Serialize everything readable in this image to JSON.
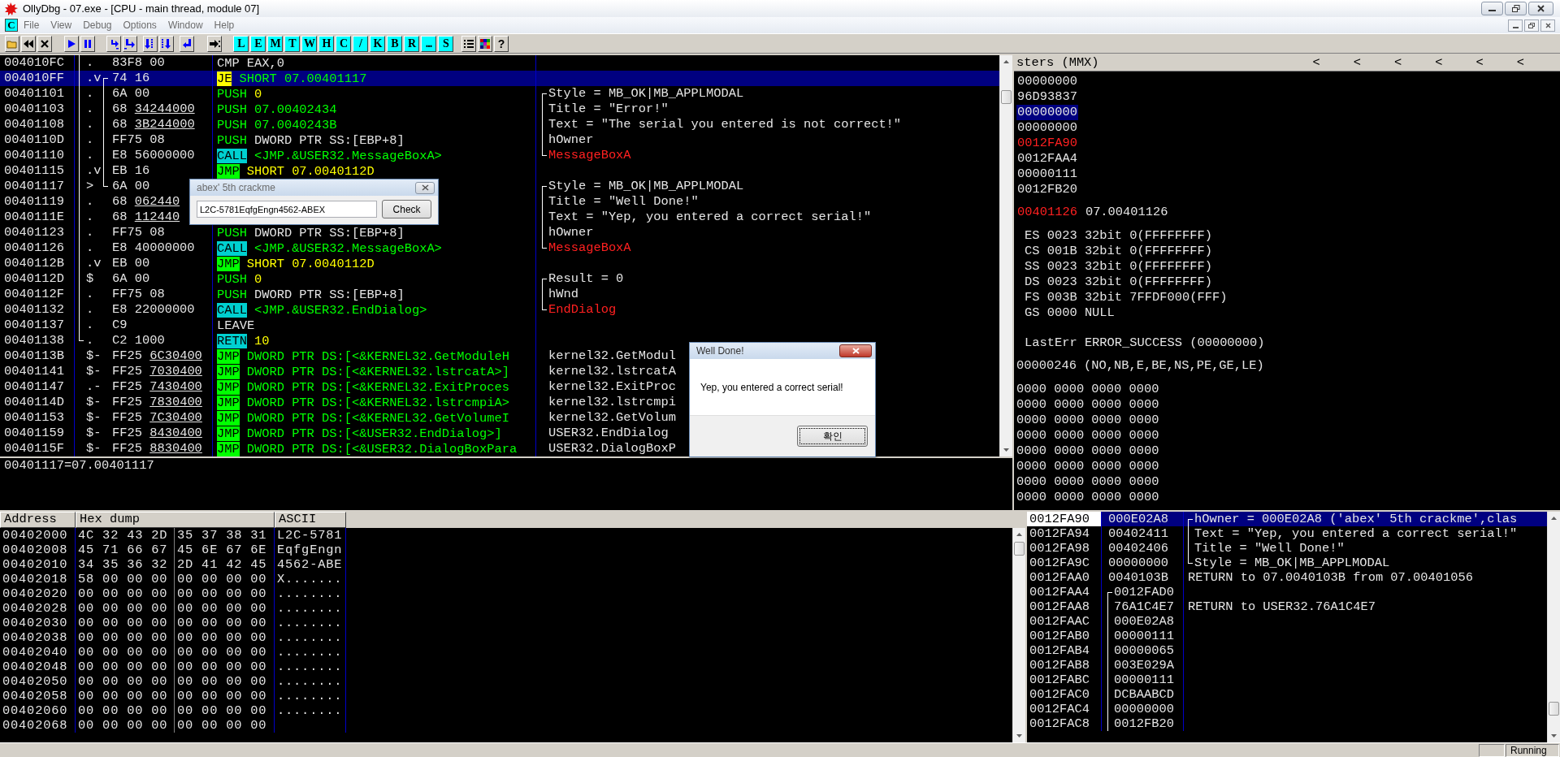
{
  "window": {
    "title": "OllyDbg - 07.exe - [CPU - main thread, module 07]"
  },
  "menu": {
    "icon_letter": "C",
    "items": [
      "File",
      "View",
      "Debug",
      "Options",
      "Window",
      "Help"
    ]
  },
  "toolbar": {
    "letter_buttons": [
      "L",
      "E",
      "M",
      "T",
      "W",
      "H",
      "C",
      "/",
      "K",
      "B",
      "R",
      "...",
      "S"
    ],
    "help_button": "?"
  },
  "disassembly": {
    "rows": [
      {
        "address": "004010FC",
        "mark": ".",
        "hex": "83F8 00",
        "mnemonic": {
          "text": "CMP",
          "kind": "plain"
        },
        "operand": {
          "text": "EAX,0",
          "kind": "plain"
        },
        "selected": false,
        "proc_bracket": {
          "kind": "middle"
        }
      },
      {
        "address": "004010FF",
        "mark": ".v",
        "hex": "74 16",
        "mnemonic": {
          "text": "JE",
          "kind": "cond_jump"
        },
        "operand": {
          "text": "SHORT 07.00401117",
          "kind": "label"
        },
        "selected": true,
        "proc_bracket": {
          "kind": "middle"
        },
        "jump_bracket": {
          "kind": "top"
        }
      },
      {
        "address": "00401101",
        "mark": ".",
        "hex": "6A 00",
        "mnemonic": {
          "text": "PUSH",
          "kind": "push"
        },
        "operand": {
          "text": "0",
          "kind": "const"
        },
        "comment": {
          "text": "Style = MB_OK|MB_APPLMODAL",
          "kind": "plain"
        },
        "comment_bracket": {
          "kind": "top"
        },
        "selected": false,
        "proc_bracket": {
          "kind": "middle"
        },
        "jump_bracket": {
          "kind": "middle"
        }
      },
      {
        "address": "00401103",
        "mark": ".",
        "hex": "68",
        "fixup": "34244000",
        "mnemonic": {
          "text": "PUSH",
          "kind": "push"
        },
        "operand": {
          "text": "07.00402434",
          "kind": "label"
        },
        "comment": {
          "text": "Title = \"Error!\"",
          "kind": "plain"
        },
        "comment_bracket": {
          "kind": "middle"
        },
        "selected": false,
        "proc_bracket": {
          "kind": "middle"
        },
        "jump_bracket": {
          "kind": "middle"
        }
      },
      {
        "address": "00401108",
        "mark": ".",
        "hex": "68",
        "fixup": "3B244000",
        "mnemonic": {
          "text": "PUSH",
          "kind": "push"
        },
        "operand": {
          "text": "07.0040243B",
          "kind": "label"
        },
        "comment": {
          "text": "Text = \"The serial you entered is not correct!\"",
          "kind": "plain"
        },
        "comment_bracket": {
          "kind": "middle"
        },
        "selected": false,
        "proc_bracket": {
          "kind": "middle"
        },
        "jump_bracket": {
          "kind": "middle"
        }
      },
      {
        "address": "0040110D",
        "mark": ".",
        "hex": "FF75 08",
        "mnemonic": {
          "text": "PUSH",
          "kind": "push"
        },
        "operand": {
          "text": "DWORD PTR SS:[EBP+8]",
          "kind": "plain"
        },
        "comment": {
          "text": "hOwner",
          "kind": "plain"
        },
        "comment_bracket": {
          "kind": "middle"
        },
        "selected": false,
        "proc_bracket": {
          "kind": "middle"
        },
        "jump_bracket": {
          "kind": "middle"
        }
      },
      {
        "address": "00401110",
        "mark": ".",
        "hex": "E8 56000000",
        "mnemonic": {
          "text": "CALL",
          "kind": "call"
        },
        "operand": {
          "text": "<JMP.&USER32.MessageBoxA>",
          "kind": "label"
        },
        "comment": {
          "text": "MessageBoxA",
          "kind": "api"
        },
        "comment_bracket": {
          "kind": "bottom"
        },
        "selected": false,
        "proc_bracket": {
          "kind": "middle"
        },
        "jump_bracket": {
          "kind": "middle"
        }
      },
      {
        "address": "00401115",
        "mark": ".v",
        "hex": "EB 16",
        "mnemonic": {
          "text": "JMP",
          "kind": "jump"
        },
        "operand": {
          "text": "SHORT 07.0040112D",
          "kind": "const"
        },
        "selected": false,
        "proc_bracket": {
          "kind": "middle"
        },
        "jump_bracket": {
          "kind": "middle"
        }
      },
      {
        "address": "00401117",
        "mark": ">",
        "hex": "6A 00",
        "comment": {
          "text": "Style = MB_OK|MB_APPLMODAL",
          "kind": "plain"
        },
        "comment_bracket": {
          "kind": "top"
        },
        "selected": false,
        "proc_bracket": {
          "kind": "middle"
        },
        "jump_bracket": {
          "kind": "bottom"
        }
      },
      {
        "address": "00401119",
        "mark": ".",
        "hex": "68",
        "fixup": "062440",
        "comment": {
          "text": "Title = \"Well Done!\"",
          "kind": "plain"
        },
        "comment_bracket": {
          "kind": "middle"
        },
        "selected": false,
        "proc_bracket": {
          "kind": "middle"
        }
      },
      {
        "address": "0040111E",
        "mark": ".",
        "hex": "68",
        "fixup": "112440",
        "comment": {
          "text": "Text = \"Yep, you entered a correct serial!\"",
          "kind": "plain"
        },
        "comment_bracket": {
          "kind": "middle"
        },
        "selected": false,
        "proc_bracket": {
          "kind": "middle"
        }
      },
      {
        "address": "00401123",
        "mark": ".",
        "hex": "FF75 08",
        "mnemonic": {
          "text": "PUSH",
          "kind": "push"
        },
        "operand": {
          "text": "DWORD PTR SS:[EBP+8]",
          "kind": "plain"
        },
        "comment": {
          "text": "hOwner",
          "kind": "plain"
        },
        "comment_bracket": {
          "kind": "middle"
        },
        "selected": false,
        "proc_bracket": {
          "kind": "middle"
        }
      },
      {
        "address": "00401126",
        "mark": ".",
        "hex": "E8 40000000",
        "mnemonic": {
          "text": "CALL",
          "kind": "call"
        },
        "operand": {
          "text": "<JMP.&USER32.MessageBoxA>",
          "kind": "label"
        },
        "comment": {
          "text": "MessageBoxA",
          "kind": "api"
        },
        "comment_bracket": {
          "kind": "bottom"
        },
        "selected": false,
        "proc_bracket": {
          "kind": "middle"
        }
      },
      {
        "address": "0040112B",
        "mark": ".v",
        "hex": "EB 00",
        "mnemonic": {
          "text": "JMP",
          "kind": "jump"
        },
        "operand": {
          "text": "SHORT 07.0040112D",
          "kind": "const"
        },
        "selected": false,
        "proc_bracket": {
          "kind": "middle"
        }
      },
      {
        "address": "0040112D",
        "mark": "$",
        "hex": "6A 00",
        "mnemonic": {
          "text": "PUSH",
          "kind": "push"
        },
        "operand": {
          "text": "0",
          "kind": "const"
        },
        "comment": {
          "text": "Result = 0",
          "kind": "plain"
        },
        "comment_bracket": {
          "kind": "top"
        },
        "selected": false,
        "proc_bracket": {
          "kind": "middle"
        }
      },
      {
        "address": "0040112F",
        "mark": ".",
        "hex": "FF75 08",
        "mnemonic": {
          "text": "PUSH",
          "kind": "push"
        },
        "operand": {
          "text": "DWORD PTR SS:[EBP+8]",
          "kind": "plain"
        },
        "comment": {
          "text": "hWnd",
          "kind": "plain"
        },
        "comment_bracket": {
          "kind": "middle"
        },
        "selected": false,
        "proc_bracket": {
          "kind": "middle"
        }
      },
      {
        "address": "00401132",
        "mark": ".",
        "hex": "E8 22000000",
        "mnemonic": {
          "text": "CALL",
          "kind": "call"
        },
        "operand": {
          "text": "<JMP.&USER32.EndDialog>",
          "kind": "label"
        },
        "comment": {
          "text": "EndDialog",
          "kind": "api"
        },
        "comment_bracket": {
          "kind": "bottom"
        },
        "selected": false,
        "proc_bracket": {
          "kind": "middle"
        }
      },
      {
        "address": "00401137",
        "mark": ".",
        "hex": "C9",
        "mnemonic": {
          "text": "LEAVE",
          "kind": "plain"
        },
        "selected": false,
        "proc_bracket": {
          "kind": "middle"
        }
      },
      {
        "address": "00401138",
        "mark": ".",
        "hex": "C2 1000",
        "mnemonic": {
          "text": "RETN",
          "kind": "return"
        },
        "operand": {
          "text": "10",
          "kind": "const"
        },
        "selected": false,
        "proc_bracket": {
          "kind": "bottom"
        }
      },
      {
        "address": "0040113B",
        "mark": "$-",
        "hex": "FF25",
        "fixup": "6C30400",
        "mnemonic": {
          "text": "JMP",
          "kind": "jump"
        },
        "operand": {
          "text": "DWORD PTR DS:[<&KERNEL32.GetModuleH",
          "kind": "label"
        },
        "comment": {
          "text": "kernel32.GetModul",
          "kind": "plain"
        },
        "selected": false
      },
      {
        "address": "00401141",
        "mark": "$-",
        "hex": "FF25",
        "fixup": "7030400",
        "mnemonic": {
          "text": "JMP",
          "kind": "jump"
        },
        "operand": {
          "text": "DWORD PTR DS:[<&KERNEL32.lstrcatA>]",
          "kind": "label"
        },
        "comment": {
          "text": "kernel32.lstrcatA",
          "kind": "plain"
        },
        "selected": false
      },
      {
        "address": "00401147",
        "mark": ".-",
        "hex": "FF25",
        "fixup": "7430400",
        "mnemonic": {
          "text": "JMP",
          "kind": "jump"
        },
        "operand": {
          "text": "DWORD PTR DS:[<&KERNEL32.ExitProces",
          "kind": "label"
        },
        "comment": {
          "text": "kernel32.ExitProc",
          "kind": "plain"
        },
        "selected": false
      },
      {
        "address": "0040114D",
        "mark": "$-",
        "hex": "FF25",
        "fixup": "7830400",
        "mnemonic": {
          "text": "JMP",
          "kind": "jump"
        },
        "operand": {
          "text": "DWORD PTR DS:[<&KERNEL32.lstrcmpiA>",
          "kind": "label"
        },
        "comment": {
          "text": "kernel32.lstrcmpi",
          "kind": "plain"
        },
        "selected": false
      },
      {
        "address": "00401153",
        "mark": "$-",
        "hex": "FF25",
        "fixup": "7C30400",
        "mnemonic": {
          "text": "JMP",
          "kind": "jump"
        },
        "operand": {
          "text": "DWORD PTR DS:[<&KERNEL32.GetVolumeI",
          "kind": "label"
        },
        "comment": {
          "text": "kernel32.GetVolum",
          "kind": "plain"
        },
        "selected": false
      },
      {
        "address": "00401159",
        "mark": "$-",
        "hex": "FF25",
        "fixup": "8430400",
        "mnemonic": {
          "text": "JMP",
          "kind": "jump"
        },
        "operand": {
          "text": "DWORD PTR DS:[<&USER32.EndDialog>]",
          "kind": "label"
        },
        "comment": {
          "text": "USER32.EndDialog",
          "kind": "plain"
        },
        "selected": false
      },
      {
        "address": "0040115F",
        "mark": "$-",
        "hex": "FF25",
        "fixup": "8830400",
        "mnemonic": {
          "text": "JMP",
          "kind": "jump"
        },
        "operand": {
          "text": "DWORD PTR DS:[<&USER32.DialogBoxPara",
          "kind": "label"
        },
        "comment": {
          "text": "USER32.DialogBoxP",
          "kind": "plain"
        },
        "selected": false
      }
    ],
    "info_line": "00401117=07.00401117"
  },
  "registers": {
    "header": "sters (MMX)",
    "header_buttons": [
      "<",
      "<",
      "<",
      "<",
      "<",
      "<"
    ],
    "general": [
      {
        "value": "00000000",
        "changed": false,
        "selected": false
      },
      {
        "value": "96D93837",
        "changed": false,
        "selected": false
      },
      {
        "value": "00000000",
        "changed": false,
        "selected": true
      },
      {
        "value": "00000000",
        "changed": false,
        "selected": false
      },
      {
        "value": "0012FA90",
        "changed": true,
        "selected": false
      },
      {
        "value": "0012FAA4",
        "changed": false,
        "selected": false
      },
      {
        "value": "00000111",
        "changed": false,
        "selected": false
      },
      {
        "value": "0012FB20",
        "changed": false,
        "selected": false
      }
    ],
    "eip": {
      "value": "00401126",
      "changed": true,
      "comment": "07.00401126"
    },
    "segments": [
      "ES 0023 32bit 0(FFFFFFFF)",
      "CS 001B 32bit 0(FFFFFFFF)",
      "SS 0023 32bit 0(FFFFFFFF)",
      "DS 0023 32bit 0(FFFFFFFF)",
      "FS 003B 32bit 7FFDF000(FFF)",
      "GS 0000 NULL"
    ],
    "last_error": "LastErr ERROR_SUCCESS (00000000)",
    "flags": "00000246 (NO,NB,E,BE,NS,PE,GE,LE)",
    "mmx": [
      "0000 0000 0000 0000",
      "0000 0000 0000 0000",
      "0000 0000 0000 0000",
      "0000 0000 0000 0000",
      "0000 0000 0000 0000",
      "0000 0000 0000 0000",
      "0000 0000 0000 0000",
      "0000 0000 0000 0000"
    ]
  },
  "dump": {
    "columns": [
      "Address",
      "Hex dump",
      "ASCII"
    ],
    "rows": [
      {
        "address": "00402000",
        "hex_1": "4C 32 43 2D",
        "hex_2": "35 37 38 31",
        "ascii": "L2C-5781"
      },
      {
        "address": "00402008",
        "hex_1": "45 71 66 67",
        "hex_2": "45 6E 67 6E",
        "ascii": "EqfgEngn"
      },
      {
        "address": "00402010",
        "hex_1": "34 35 36 32",
        "hex_2": "2D 41 42 45",
        "ascii": "4562-ABE"
      },
      {
        "address": "00402018",
        "hex_1": "58 00 00 00",
        "hex_2": "00 00 00 00",
        "ascii": "X......."
      },
      {
        "address": "00402020",
        "hex_1": "00 00 00 00",
        "hex_2": "00 00 00 00",
        "ascii": "........"
      },
      {
        "address": "00402028",
        "hex_1": "00 00 00 00",
        "hex_2": "00 00 00 00",
        "ascii": "........"
      },
      {
        "address": "00402030",
        "hex_1": "00 00 00 00",
        "hex_2": "00 00 00 00",
        "ascii": "........"
      },
      {
        "address": "00402038",
        "hex_1": "00 00 00 00",
        "hex_2": "00 00 00 00",
        "ascii": "........"
      },
      {
        "address": "00402040",
        "hex_1": "00 00 00 00",
        "hex_2": "00 00 00 00",
        "ascii": "........"
      },
      {
        "address": "00402048",
        "hex_1": "00 00 00 00",
        "hex_2": "00 00 00 00",
        "ascii": "........"
      },
      {
        "address": "00402050",
        "hex_1": "00 00 00 00",
        "hex_2": "00 00 00 00",
        "ascii": "........"
      },
      {
        "address": "00402058",
        "hex_1": "00 00 00 00",
        "hex_2": "00 00 00 00",
        "ascii": "........"
      },
      {
        "address": "00402060",
        "hex_1": "00 00 00 00",
        "hex_2": "00 00 00 00",
        "ascii": "........"
      },
      {
        "address": "00402068",
        "hex_1": "00 00 00 00",
        "hex_2": "00 00 00 00"
      }
    ]
  },
  "stack": {
    "rows": [
      {
        "address": "0012FA90",
        "value": "000E02A8",
        "comment": "hOwner = 000E02A8 ('abex' 5th crackme',clas",
        "comment_bracket": {
          "kind": "top"
        },
        "selected": true
      },
      {
        "address": "0012FA94",
        "value": "00402411",
        "comment": "Text = \"Yep, you entered a correct serial!\"",
        "comment_bracket": {
          "kind": "middle"
        },
        "selected": false
      },
      {
        "address": "0012FA98",
        "value": "00402406",
        "comment": "Title = \"Well Done!\"",
        "comment_bracket": {
          "kind": "middle"
        },
        "selected": false
      },
      {
        "address": "0012FA9C",
        "value": "00000000",
        "comment": "Style = MB_OK|MB_APPLMODAL",
        "comment_bracket": {
          "kind": "bottom"
        },
        "selected": false
      },
      {
        "address": "0012FAA0",
        "value": "0040103B",
        "comment": "RETURN to 07.0040103B from 07.00401056",
        "selected": false
      },
      {
        "address": "0012FAA4",
        "value": "0012FAD0",
        "value_bracket": {
          "kind": "top"
        },
        "selected": false
      },
      {
        "address": "0012FAA8",
        "value": "76A1C4E7",
        "value_bracket": {
          "kind": "middle"
        },
        "comment": "RETURN to USER32.76A1C4E7",
        "selected": false
      },
      {
        "address": "0012FAAC",
        "value": "000E02A8",
        "value_bracket": {
          "kind": "middle"
        },
        "selected": false
      },
      {
        "address": "0012FAB0",
        "value": "00000111",
        "value_bracket": {
          "kind": "middle"
        },
        "selected": false
      },
      {
        "address": "0012FAB4",
        "value": "00000065",
        "value_bracket": {
          "kind": "middle"
        },
        "selected": false
      },
      {
        "address": "0012FAB8",
        "value": "003E029A",
        "value_bracket": {
          "kind": "middle"
        },
        "selected": false
      },
      {
        "address": "0012FABC",
        "value": "00000111",
        "value_bracket": {
          "kind": "middle"
        },
        "selected": false
      },
      {
        "address": "0012FAC0",
        "value": "DCBAABCD",
        "value_bracket": {
          "kind": "middle"
        },
        "selected": false
      },
      {
        "address": "0012FAC4",
        "value": "00000000",
        "value_bracket": {
          "kind": "middle"
        },
        "selected": false
      },
      {
        "address": "0012FAC8",
        "value": "0012FB20",
        "value_bracket": {
          "kind": "middle"
        },
        "selected": false
      }
    ]
  },
  "status_bar": {
    "state": "Running"
  },
  "dialogs": [
    {
      "kind": "input",
      "title": "abex' 5th crackme",
      "value": "L2C-5781EqfgEngn4562-ABEX",
      "button": "Check"
    },
    {
      "kind": "message",
      "title": "Well Done!",
      "message": "Yep, you entered a correct serial!",
      "button": "확인"
    }
  ]
}
